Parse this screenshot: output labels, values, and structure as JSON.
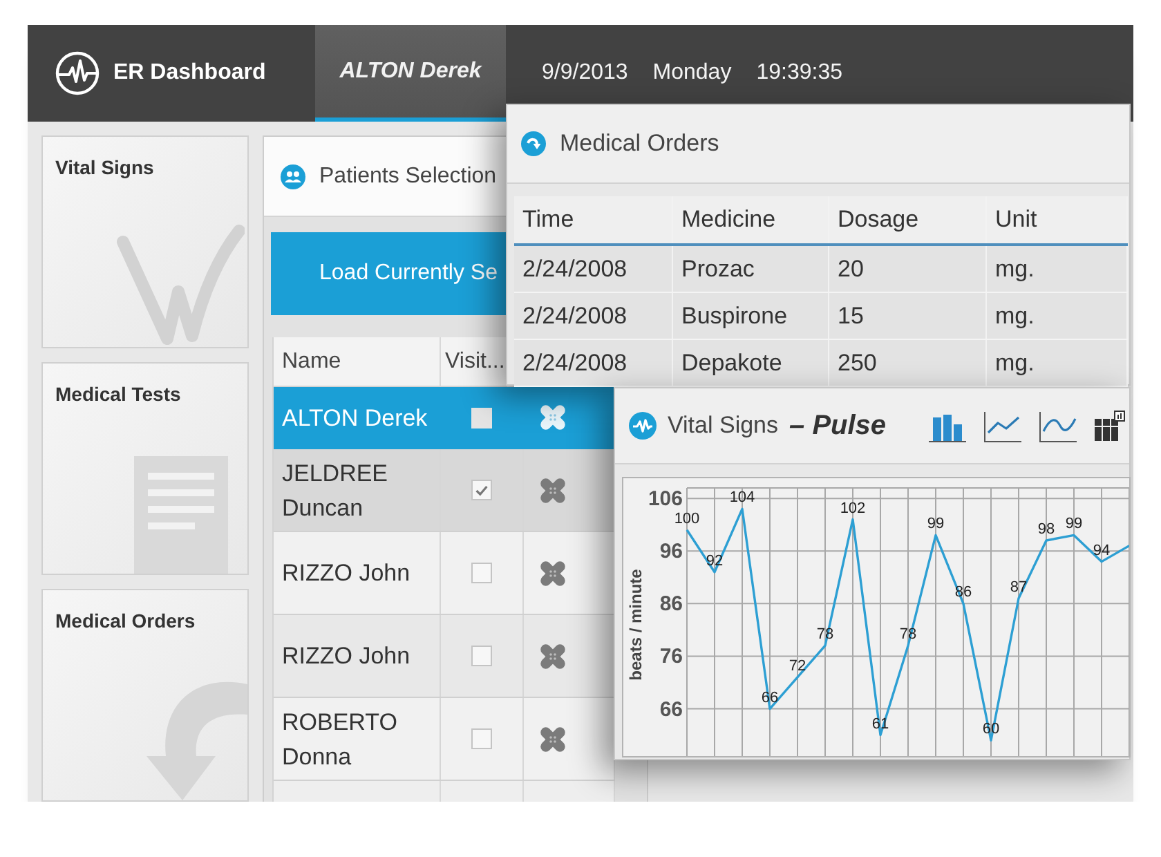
{
  "header": {
    "app_title": "ER Dashboard",
    "tabs": [
      {
        "label": "ALTON Derek",
        "selected": true
      }
    ],
    "date": "9/9/2013",
    "weekday": "Monday",
    "time": "19:39:35"
  },
  "sidebar": {
    "tiles": [
      {
        "label": "Vital Signs",
        "kind": "vitals"
      },
      {
        "label": "Medical Tests",
        "kind": "tests"
      },
      {
        "label": "Medical Orders",
        "kind": "orders"
      }
    ]
  },
  "patients_panel": {
    "title": "Patients Selection",
    "load_button": "Load Currently Se",
    "columns": [
      "Name",
      "Visit..."
    ],
    "rows": [
      {
        "name": "ALTON Derek",
        "selected": true,
        "highlighted": false,
        "checked": false
      },
      {
        "name": "JELDREE Duncan",
        "selected": false,
        "highlighted": true,
        "checked": true
      },
      {
        "name": "RIZZO John",
        "selected": false,
        "highlighted": false,
        "checked": false
      },
      {
        "name": "RIZZO John",
        "selected": false,
        "highlighted": false,
        "checked": false
      },
      {
        "name": "ROBERTO Donna",
        "selected": false,
        "highlighted": false,
        "checked": false
      }
    ]
  },
  "medical_orders_window": {
    "title": "Medical Orders",
    "columns": [
      "Time",
      "Medicine",
      "Dosage",
      "Unit"
    ],
    "rows": [
      [
        "2/24/2008",
        "Prozac",
        "20",
        "mg."
      ],
      [
        "2/24/2008",
        "Buspirone",
        "15",
        "mg."
      ],
      [
        "2/24/2008",
        "Depakote",
        "250",
        "mg."
      ]
    ]
  },
  "vital_signs_window": {
    "title": "Vital Signs",
    "subtitle": "– Pulse",
    "toolbar": [
      {
        "kind": "bar"
      },
      {
        "kind": "line"
      },
      {
        "kind": "spline"
      },
      {
        "kind": "grid"
      }
    ],
    "chart_data": {
      "type": "line",
      "ylabel": "beats / minute",
      "values": [
        100,
        92,
        104,
        66,
        72,
        78,
        102,
        61,
        78,
        99,
        86,
        60,
        87,
        98,
        99,
        94,
        97
      ],
      "ylim": [
        57,
        108
      ],
      "yticks": [
        66,
        76,
        86,
        96,
        106
      ],
      "grid": true,
      "value_labels": [
        "100",
        "92",
        "104",
        "66",
        "72",
        "78",
        "102",
        "61",
        "78",
        "99",
        "86",
        "60",
        "87",
        "98",
        "99",
        "94",
        null
      ]
    }
  }
}
